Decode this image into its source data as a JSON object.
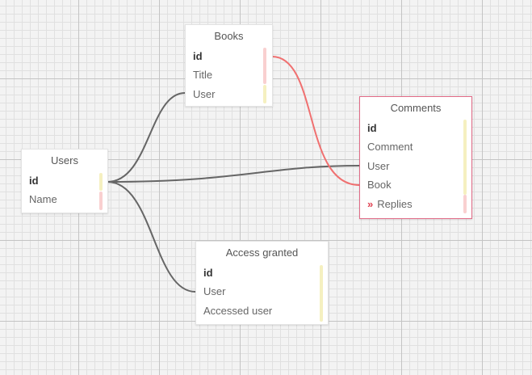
{
  "tables": {
    "books": {
      "title": "Books",
      "fields": [
        "id",
        "Title",
        "User"
      ]
    },
    "comments": {
      "title": "Comments",
      "fields": [
        "id",
        "Comment",
        "User",
        "Book",
        "Replies"
      ],
      "replies_marker": "»"
    },
    "users": {
      "title": "Users",
      "fields": [
        "id",
        "Name"
      ]
    },
    "access": {
      "title": "Access granted",
      "fields": [
        "id",
        "User",
        "Accessed user"
      ]
    }
  },
  "colors": {
    "link_default": "#666666",
    "link_selected": "#f07070",
    "selected_border": "#e06a86",
    "bar_pink": "#f9d0d0",
    "bar_yellow": "#f5f0c0"
  }
}
